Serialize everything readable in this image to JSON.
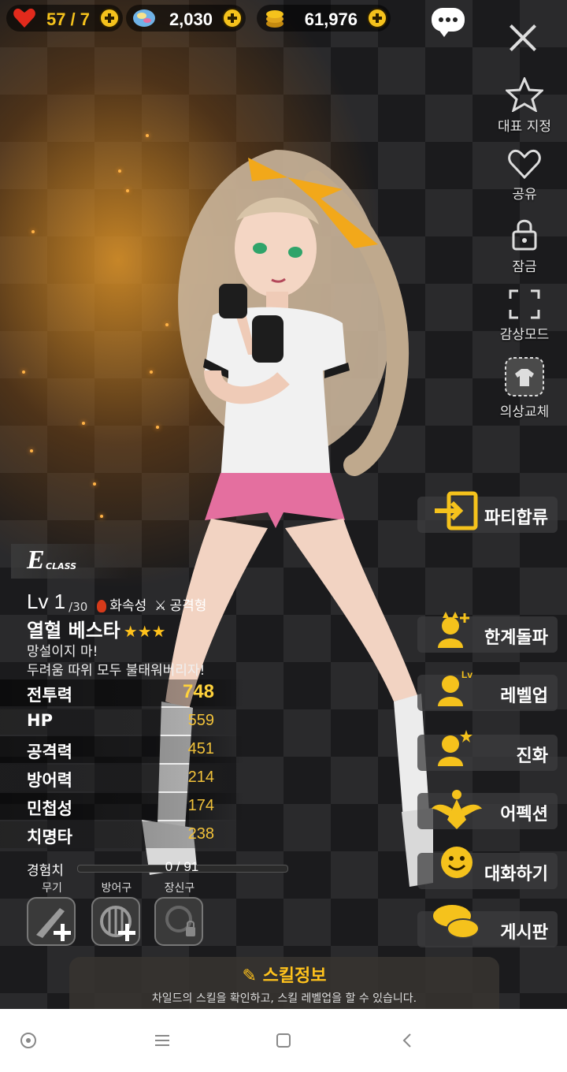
{
  "currency": {
    "stamina": "57 / 7",
    "gems": "2,030",
    "gold": "61,976"
  },
  "side_menu": {
    "representative": "대표 지정",
    "share": "공유",
    "lock": "잠금",
    "view_mode": "감상모드",
    "costume": "의상교체"
  },
  "actions": {
    "party_join": "파티합류",
    "limit_break": "한계돌파",
    "level_up": "레벨업",
    "evolve": "진화",
    "affection": "어펙션",
    "talk": "대화하기",
    "board": "게시판"
  },
  "character": {
    "class_letter": "E",
    "class_word": "CLASS",
    "level": "Lv 1",
    "level_max": "/30",
    "element": "화속성",
    "role": "공격형",
    "name": "열혈 베스타",
    "stars": "★★★",
    "quote_line1": "망설이지 마!",
    "quote_line2": "두려움 따위 모두 불태워버리자!"
  },
  "stats": [
    {
      "label": "전투력",
      "value": "748"
    },
    {
      "label": "HP",
      "value": "559"
    },
    {
      "label": "공격력",
      "value": "451"
    },
    {
      "label": "방어력",
      "value": "214"
    },
    {
      "label": "민첩성",
      "value": "174"
    },
    {
      "label": "치명타",
      "value": "238"
    }
  ],
  "experience": {
    "label": "경험치",
    "value": "0 / 91",
    "progress": 0
  },
  "equipment": {
    "weapon": "무기",
    "armor": "방어구",
    "accessory": "장신구"
  },
  "skill": {
    "title": "스킬정보",
    "description": "차일드의 스킬을 확인하고, 스킬 레벨업을 할 수 있습니다."
  },
  "colors": {
    "accent_gold": "#ffc21c",
    "stat_value": "#f2c23a"
  }
}
